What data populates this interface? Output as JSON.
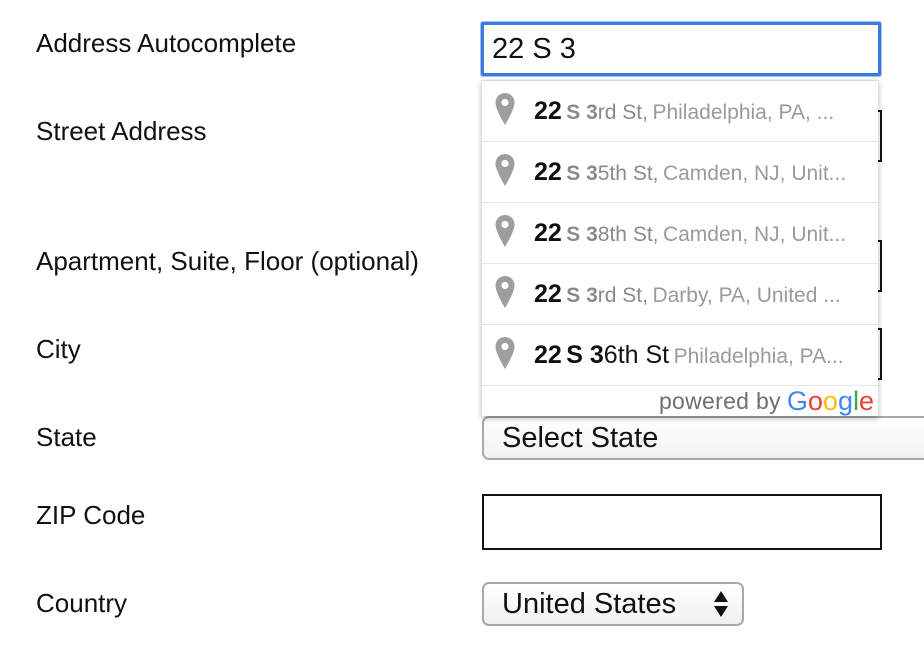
{
  "form": {
    "address_autocomplete": {
      "label": "Address Autocomplete",
      "value": "22 S 3"
    },
    "street_address": {
      "label": "Street Address"
    },
    "apartment": {
      "label": "Apartment, Suite, Floor (optional)"
    },
    "city": {
      "label": "City"
    },
    "state": {
      "label": "State",
      "selected": "Select State"
    },
    "zip": {
      "label": "ZIP Code",
      "value": ""
    },
    "country": {
      "label": "Country",
      "selected": "United States"
    }
  },
  "autocomplete": {
    "suggestions": [
      {
        "number": "22",
        "street_bold": "S 3",
        "street_rest": "rd St,",
        "secondary": "Philadelphia, PA, ..."
      },
      {
        "number": "22",
        "street_bold": "S 3",
        "street_rest": "5th St,",
        "secondary": "Camden, NJ, Unit..."
      },
      {
        "number": "22",
        "street_bold": "S 3",
        "street_rest": "8th St,",
        "secondary": "Camden, NJ, Unit..."
      },
      {
        "number": "22",
        "street_bold": "S 3",
        "street_rest": "rd St,",
        "secondary": "Darby, PA, United ..."
      },
      {
        "number": "22",
        "street_bold": "S 3",
        "street_rest": "6th St",
        "secondary": "Philadelphia, PA..."
      }
    ],
    "powered_by": "powered by",
    "brand_letters": [
      "G",
      "o",
      "o",
      "g",
      "l",
      "e"
    ],
    "brand_colors": [
      "#4285F4",
      "#EA4335",
      "#FBBC05",
      "#4285F4",
      "#34A853",
      "#EA4335"
    ],
    "pin_icon": "map-pin-icon",
    "pin_color": "#9e9e9e"
  },
  "colors": {
    "focus_ring": "#3b7ae0"
  }
}
